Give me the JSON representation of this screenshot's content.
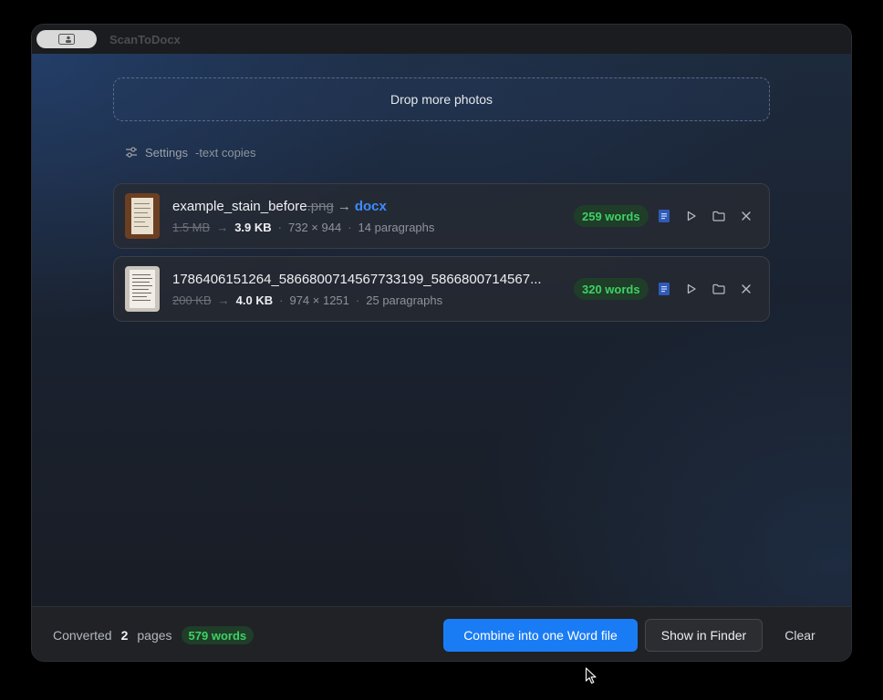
{
  "app": {
    "title": "ScanToDocx"
  },
  "dropzone": {
    "label": "Drop more photos"
  },
  "settings": {
    "label": "Settings",
    "detail": "-text copies"
  },
  "files": [
    {
      "name": "example_stain_before",
      "ext": ".png",
      "arrow": "→",
      "target": "docx",
      "size_before": "1.5 MB",
      "size_after": "3.9 KB",
      "dimensions": "732 × 944",
      "paragraphs": "14 paragraphs",
      "words": "259 words"
    },
    {
      "name": "1786406151264_5866800714567733199_5866800714567...",
      "size_before": "200 KB",
      "size_after": "4.0 KB",
      "dimensions": "974 × 1251",
      "paragraphs": "25 paragraphs",
      "words": "320 words"
    }
  ],
  "footer": {
    "converted_label": "Converted",
    "page_count": "2",
    "pages_label": "pages",
    "total_words": "579 words",
    "combine_label": "Combine into one Word file",
    "finder_label": "Show in Finder",
    "clear_label": "Clear"
  },
  "colors": {
    "accent": "#1a7cf5",
    "docx_link": "#3d8bff",
    "badge_bg": "#1f3d28",
    "badge_text": "#3fd165"
  },
  "icons": {
    "titlebar": "sidebar-toggle-icon",
    "settings": "sliders-icon",
    "row_actions": [
      "word-doc-icon",
      "play-icon",
      "folder-icon",
      "close-icon"
    ]
  }
}
